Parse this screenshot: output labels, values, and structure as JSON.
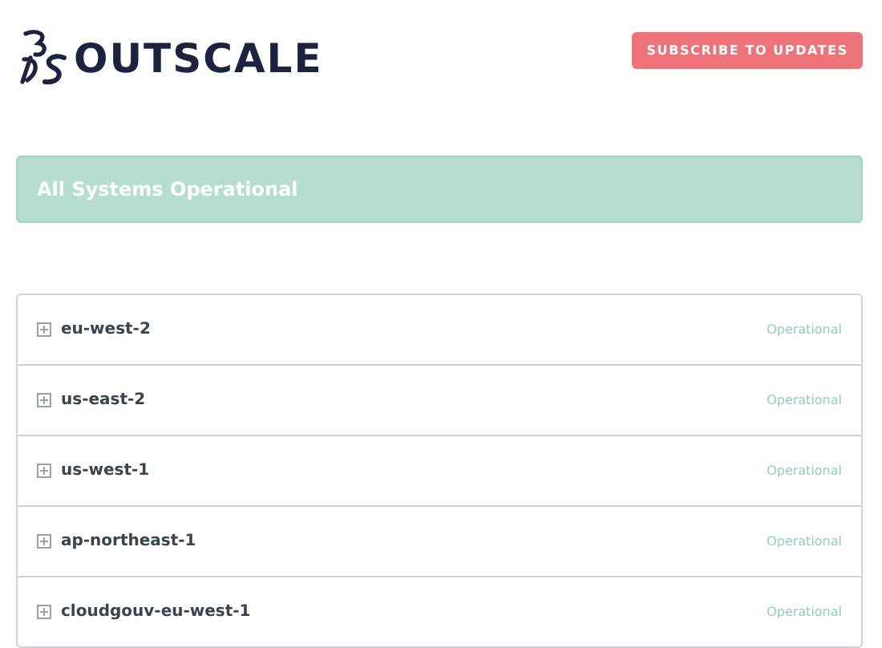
{
  "header": {
    "brand": "OUTSCALE",
    "subscribe_button": "SUBSCRIBE TO UPDATES"
  },
  "banner": {
    "text": "All Systems Operational"
  },
  "components": [
    {
      "name": "eu-west-2",
      "status": "Operational",
      "expanded": false
    },
    {
      "name": "us-east-2",
      "status": "Operational",
      "expanded": false
    },
    {
      "name": "us-west-1",
      "status": "Operational",
      "expanded": false
    },
    {
      "name": "ap-northeast-1",
      "status": "Operational",
      "expanded": false
    },
    {
      "name": "cloudgouv-eu-west-1",
      "status": "Operational",
      "expanded": false
    }
  ]
}
